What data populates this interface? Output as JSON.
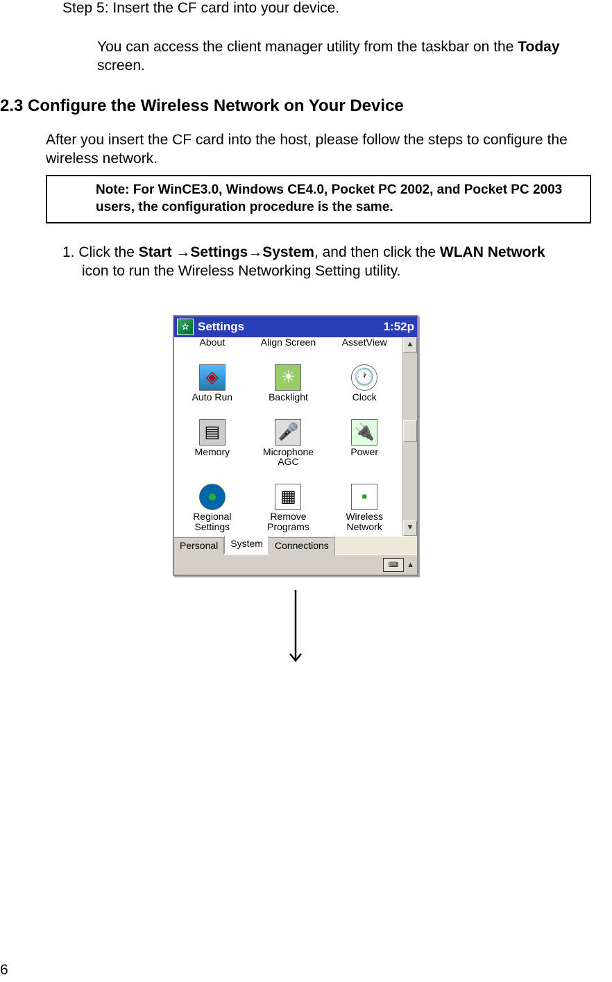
{
  "doc": {
    "step5": "Step 5: Insert the CF card into your device.",
    "access_line1": "You can access the client manager utility from the taskbar on the ",
    "access_bold": "Today",
    "access_line2": " screen.",
    "heading": "2.3 Configure the Wireless Network on Your Device",
    "after_insert": "After you insert the CF card into the host, please follow the steps to configure the wireless network.",
    "note": "Note: For WinCE3.0, Windows CE4.0, Pocket PC 2002, and Pocket PC 2003 users, the configuration procedure is the same.",
    "instr_pre": "1. Click the ",
    "instr_bold1": "Start →Settings→System",
    "instr_mid": ", and then click the ",
    "instr_bold2": "WLAN Network",
    "instr_post": " icon to run the Wireless Networking Setting utility.",
    "page_number": "6"
  },
  "pda": {
    "title": "Settings",
    "clock": "1:52p",
    "apps_row0": [
      {
        "label": "About"
      },
      {
        "label": "Align Screen"
      },
      {
        "label": "AssetView"
      }
    ],
    "apps": [
      {
        "label": "Auto Run",
        "css": "ic-autorun",
        "glyph": "◈"
      },
      {
        "label": "Backlight",
        "css": "ic-backlight",
        "glyph": "☀"
      },
      {
        "label": "Clock",
        "css": "ic-clock",
        "glyph": "🕐"
      },
      {
        "label": "Memory",
        "css": "ic-memory",
        "glyph": "▤"
      },
      {
        "label": "Microphone AGC",
        "css": "ic-mic",
        "glyph": "🎤"
      },
      {
        "label": "Power",
        "css": "ic-power",
        "glyph": "🔌"
      },
      {
        "label": "Regional Settings",
        "css": "ic-regional",
        "glyph": "●"
      },
      {
        "label": "Remove Programs",
        "css": "ic-remove",
        "glyph": "▦"
      },
      {
        "label": "Wireless Network",
        "css": "ic-wireless",
        "glyph": "▪"
      }
    ],
    "tabs": [
      {
        "label": "Personal",
        "active": false
      },
      {
        "label": "System",
        "active": true
      },
      {
        "label": "Connections",
        "active": false
      }
    ]
  }
}
